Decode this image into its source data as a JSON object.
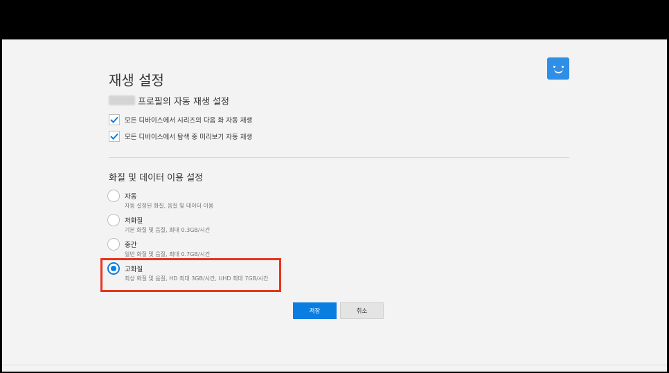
{
  "page": {
    "title": "재생 설정"
  },
  "colors": {
    "accent": "#0b7de0",
    "highlight": "#e8341c",
    "avatar": "#2f8ee6"
  },
  "autoplay": {
    "section_title": "프로필의 자동 재생 설정",
    "options": [
      {
        "label": "모든 디바이스에서 시리즈의 다음 화 자동 재생",
        "checked": true
      },
      {
        "label": "모든 디바이스에서 탐색 중 미리보기 자동 재생",
        "checked": true
      }
    ]
  },
  "quality": {
    "section_title": "화질 및 데이터 이용 설정",
    "options": [
      {
        "label": "자동",
        "desc": "자동 설정된 화질, 음질 및 데이터 이용",
        "selected": false
      },
      {
        "label": "저화질",
        "desc": "기본 화질 및 음질, 최대 0.3GB/시간",
        "selected": false
      },
      {
        "label": "중간",
        "desc": "일반 화질 및 음질, 최대 0.7GB/시간",
        "selected": false
      },
      {
        "label": "고화질",
        "desc": "최상 화질 및 음질, HD 최대 3GB/시간, UHD 최대 7GB/시간",
        "selected": true
      }
    ]
  },
  "actions": {
    "save_label": "저장",
    "cancel_label": "취소"
  }
}
